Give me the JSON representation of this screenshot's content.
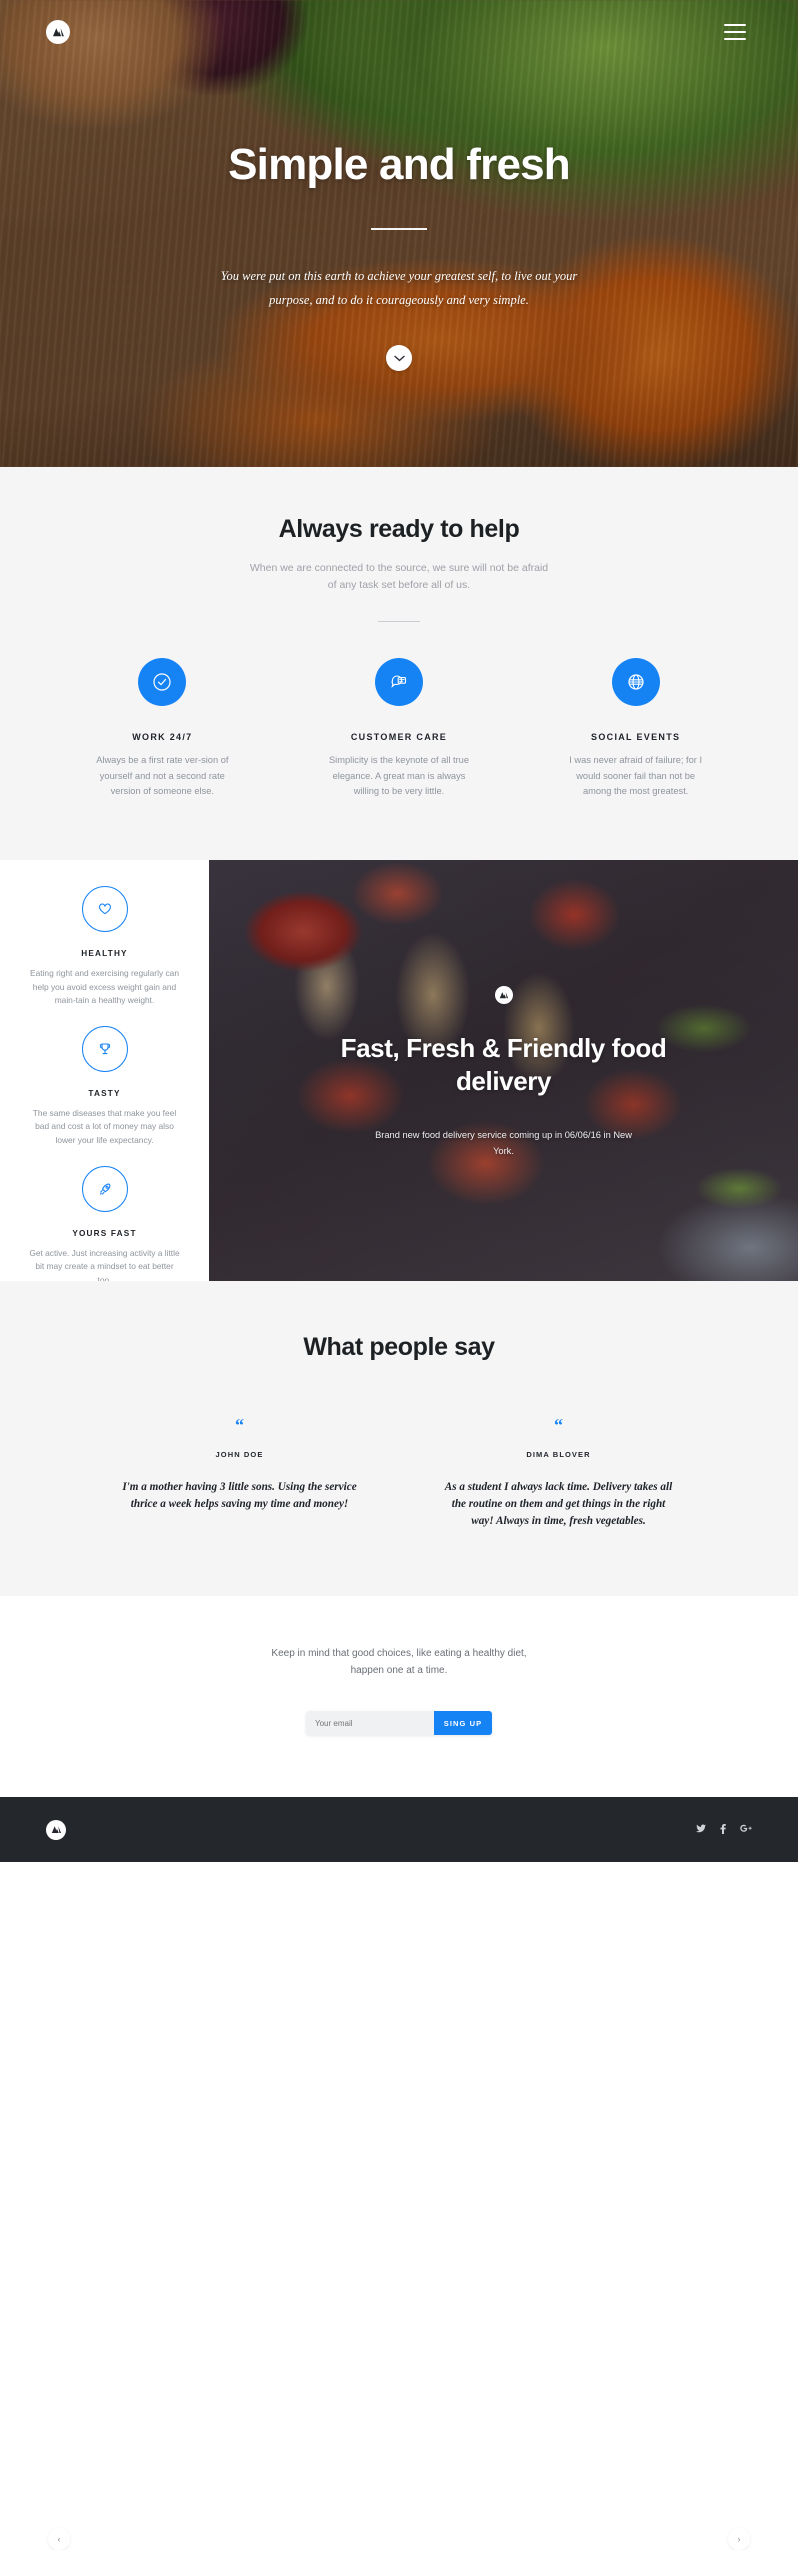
{
  "brand": {
    "logo_icon": "mountain-logo-icon"
  },
  "hero": {
    "menu_icon": "hamburger-menu-icon",
    "title": "Simple and fresh",
    "subtitle": "You were put on this earth to achieve your greatest self, to live out your purpose, and to do it courageously and very simple.",
    "scroll_icon": "chevron-down-icon"
  },
  "help": {
    "title": "Always ready to help",
    "subtitle": "When we are connected to the source, we sure will not be afraid of any task set before all of us.",
    "cards": [
      {
        "icon": "check-circle-icon",
        "title": "WORK 24/7",
        "text": "Always be a first rate ver-sion of yourself and not a second rate version of someone else."
      },
      {
        "icon": "chat-bubble-icon",
        "title": "CUSTOMER CARE",
        "text": "Simplicity is the keynote of all true elegance. A great man is always willing to be very little."
      },
      {
        "icon": "globe-icon",
        "title": "SOCIAL EVENTS",
        "text": "I was never afraid of failure; for I would sooner fail than not be among the most greatest."
      }
    ]
  },
  "features": [
    {
      "icon": "heart-icon",
      "title": "HEALTHY",
      "text": "Eating right and exercising regularly can help you avoid excess weight gain and main-tain a healthy weight."
    },
    {
      "icon": "trophy-icon",
      "title": "TASTY",
      "text": "The same diseases that make you feel bad and cost a lot of money may also lower your life expectancy."
    },
    {
      "icon": "rocket-icon",
      "title": "YOURS FAST",
      "text": "Get active. Just increasing activity a little bit may create a mindset to eat better too."
    }
  ],
  "promo": {
    "logo_icon": "mountain-logo-icon",
    "title": "Fast, Fresh & Friendly food delivery",
    "subtitle": "Brand new food delivery service coming up in 06/06/16 in New York."
  },
  "testimonials": {
    "title": "What people say",
    "prev_icon": "chevron-left-icon",
    "next_icon": "chevron-right-icon",
    "items": [
      {
        "quote_mark": "“",
        "name": "JOHN DOE",
        "text": "I'm a mother having 3 little sons. Using the service thrice a week helps saving my time and money!"
      },
      {
        "quote_mark": "“",
        "name": "DIMA BLOVER",
        "text": "As a student I always lack time. Delivery takes all the routine on them and get things in the right way! Always in time, fresh vegetables."
      }
    ]
  },
  "subscribe": {
    "text": "Keep in mind that good choices, like eating a healthy diet, happen one at a time.",
    "email_placeholder": "Your email",
    "button_label": "SING UP"
  },
  "footer": {
    "logo_icon": "mountain-logo-icon",
    "socials": [
      {
        "icon": "twitter-icon",
        "glyph": "🐦"
      },
      {
        "icon": "facebook-icon",
        "glyph": "f"
      },
      {
        "icon": "google-plus-icon",
        "glyph": "G+"
      }
    ]
  },
  "colors": {
    "accent": "#1683f5",
    "dark": "#24282c",
    "muted": "#8f959c",
    "light_bg": "#f5f5f6"
  }
}
